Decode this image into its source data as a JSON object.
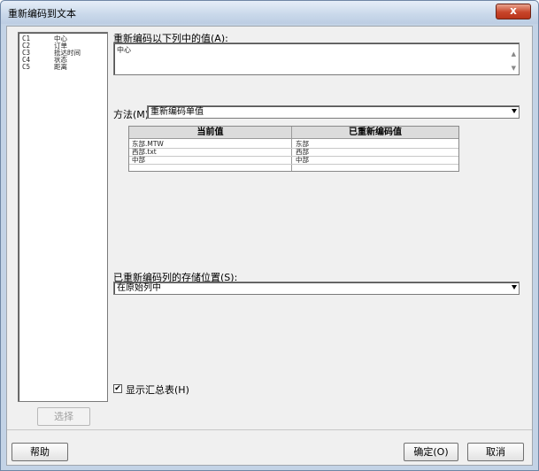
{
  "window": {
    "title": "重新编码到文本",
    "close_label": "x"
  },
  "variables": [
    {
      "code": "C1",
      "name": "中心"
    },
    {
      "code": "C2",
      "name": "订单"
    },
    {
      "code": "C3",
      "name": "抵达时间"
    },
    {
      "code": "C4",
      "name": "状态"
    },
    {
      "code": "C5",
      "name": "距离"
    }
  ],
  "buttons": {
    "select": "选择",
    "help": "帮助",
    "ok": "确定(O)",
    "cancel": "取消"
  },
  "recode_values": {
    "label": "重新编码以下列中的值(A):",
    "value": "中心"
  },
  "method": {
    "label": "方法(M):",
    "selected": "重新编码单值"
  },
  "grid": {
    "headers": [
      "当前值",
      "已重新编码值"
    ],
    "rows": [
      [
        "东部.MTW",
        "东部"
      ],
      [
        "西部.txt",
        "西部"
      ],
      [
        "中部",
        "中部"
      ]
    ]
  },
  "storage": {
    "label": "已重新编码列的存储位置(S):",
    "selected": "在原始列中"
  },
  "summary": {
    "label": "显示汇总表(H)",
    "checked": true,
    "check_mark": "✔"
  }
}
